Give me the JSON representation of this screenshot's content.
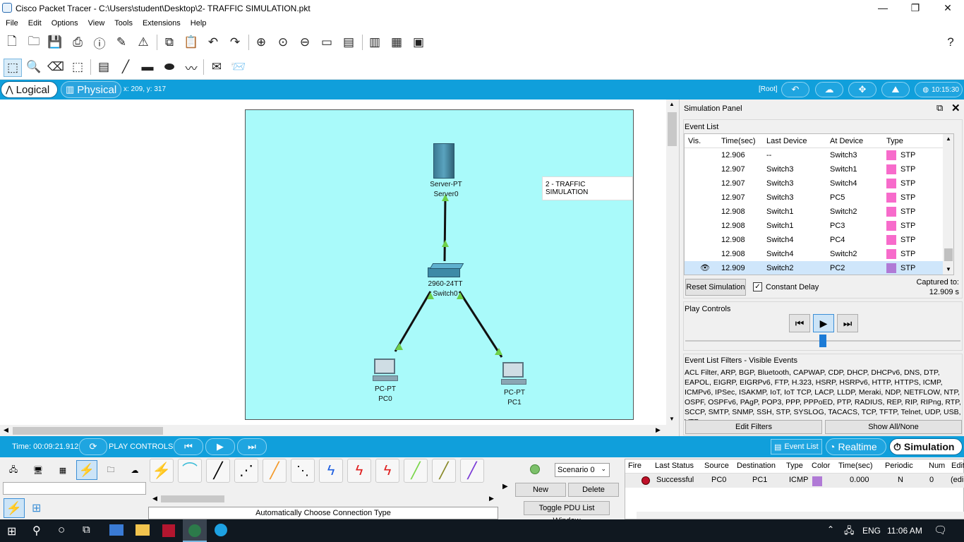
{
  "window": {
    "title": "Cisco Packet Tracer - C:\\Users\\student\\Desktop\\2- TRAFFIC SIMULATION.pkt",
    "minimize": "—",
    "maximize": "❐",
    "close": "✕"
  },
  "menu": [
    "File",
    "Edit",
    "Options",
    "View",
    "Tools",
    "Extensions",
    "Help"
  ],
  "help_glyph": "?",
  "modebar": {
    "logical": "Logical",
    "physical": "Physical",
    "coords": "x: 209, y: 317",
    "root": "[Root]",
    "clock": "10:15:30"
  },
  "canvas": {
    "title_note": "2 - TRAFFIC SIMULATION",
    "server_model": "Server-PT",
    "server_name": "Server0",
    "switch_model": "2960-24TT",
    "switch_name": "Switch0",
    "pc0_model": "PC-PT",
    "pc0_name": "PC0",
    "pc1_model": "PC-PT",
    "pc1_name": "PC1"
  },
  "sim": {
    "panel_title": "Simulation Panel",
    "event_list_label": "Event List",
    "columns": [
      "Vis.",
      "Time(sec)",
      "Last Device",
      "At Device",
      "Type"
    ],
    "events": [
      {
        "time": "12.906",
        "last": "--",
        "at": "Switch3",
        "type": "STP",
        "color": "#f76bcb"
      },
      {
        "time": "12.907",
        "last": "Switch3",
        "at": "Switch1",
        "type": "STP",
        "color": "#f76bcb"
      },
      {
        "time": "12.907",
        "last": "Switch3",
        "at": "Switch4",
        "type": "STP",
        "color": "#f76bcb"
      },
      {
        "time": "12.907",
        "last": "Switch3",
        "at": "PC5",
        "type": "STP",
        "color": "#f76bcb"
      },
      {
        "time": "12.908",
        "last": "Switch1",
        "at": "Switch2",
        "type": "STP",
        "color": "#f76bcb"
      },
      {
        "time": "12.908",
        "last": "Switch1",
        "at": "PC3",
        "type": "STP",
        "color": "#f76bcb"
      },
      {
        "time": "12.908",
        "last": "Switch4",
        "at": "PC4",
        "type": "STP",
        "color": "#f76bcb"
      },
      {
        "time": "12.908",
        "last": "Switch4",
        "at": "Switch2",
        "type": "STP",
        "color": "#f76bcb"
      },
      {
        "time": "12.909",
        "last": "Switch2",
        "at": "PC2",
        "type": "STP",
        "color": "#b07ad6"
      }
    ],
    "reset_button": "Reset Simulation",
    "constant_delay": "Constant Delay",
    "captured_to_label": "Captured to:",
    "captured_to_value": "12.909 s",
    "play_controls_label": "Play Controls",
    "filters_label": "Event List Filters - Visible Events",
    "filters_text": "ACL Filter, ARP, BGP, Bluetooth, CAPWAP, CDP, DHCP, DHCPv6, DNS, DTP, EAPOL, EIGRP, EIGRPv6, FTP, H.323, HSRP, HSRPv6, HTTP, HTTPS, ICMP, ICMPv6, IPSec, ISAKMP, IoT, IoT TCP, LACP, LLDP, Meraki, NDP, NETFLOW, NTP, OSPF, OSPFv6, PAgP, POP3, PPP, PPPoED, PTP, RADIUS, REP, RIP, RIPng, RTP, SCCP, SMTP, SNMP, SSH, STP, SYSLOG, TACACS, TCP, TFTP, Telnet, UDP, USB, VTP",
    "edit_filters": "Edit Filters",
    "show_all": "Show All/None"
  },
  "statusbar": {
    "time": "Time: 00:09:21.912",
    "play_controls": "PLAY CONTROLS:",
    "event_list": "Event List",
    "realtime": "Realtime",
    "simulation": "Simulation"
  },
  "bottom": {
    "connection_type": "Automatically Choose Connection Type",
    "scenario": "Scenario 0",
    "new": "New",
    "delete": "Delete",
    "toggle_pdu": "Toggle PDU List Window",
    "pdu_columns": [
      "Fire",
      "Last Status",
      "Source",
      "Destination",
      "Type",
      "Color",
      "Time(sec)",
      "Periodic",
      "Num",
      "Edit"
    ],
    "pdu_row": {
      "status": "Successful",
      "source": "PC0",
      "destination": "PC1",
      "type": "ICMP",
      "color": "#b07ad6",
      "time": "0.000",
      "periodic": "N",
      "num": "0",
      "edit": "(edi"
    }
  },
  "taskbar": {
    "lang": "ENG",
    "time": "11:06 AM"
  }
}
